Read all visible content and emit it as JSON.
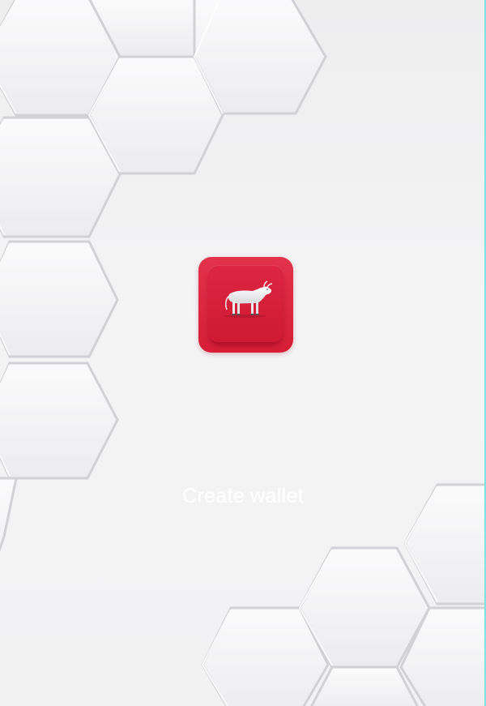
{
  "app": {
    "logo_icon": "bull-icon",
    "accent_color": "#dc233c"
  },
  "actions": {
    "create_wallet_label": "Create wallet"
  },
  "background": {
    "pattern": "hexagon-pattern",
    "base_color": "#f2f2f3",
    "edge_color": "#7fe3e6"
  }
}
